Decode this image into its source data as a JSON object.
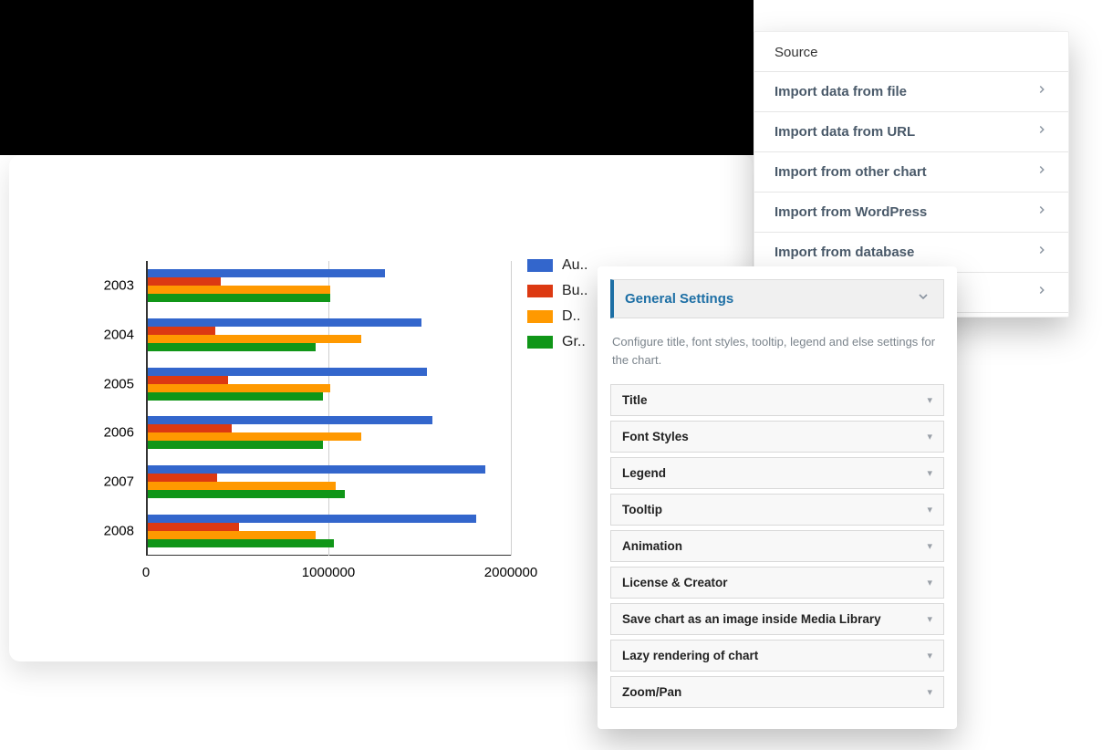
{
  "chart_data": {
    "type": "bar",
    "orientation": "horizontal",
    "categories": [
      "2003",
      "2004",
      "2005",
      "2006",
      "2007",
      "2008"
    ],
    "series": [
      {
        "name": "Au..",
        "color": "#3366cc",
        "values": [
          1300000,
          1500000,
          1530000,
          1560000,
          1850000,
          1800000
        ]
      },
      {
        "name": "Bu..",
        "color": "#dc3912",
        "values": [
          400000,
          370000,
          440000,
          460000,
          380000,
          500000
        ]
      },
      {
        "name": "D..",
        "color": "#ff9900",
        "values": [
          1000000,
          1170000,
          1000000,
          1170000,
          1030000,
          920000
        ]
      },
      {
        "name": "Gr..",
        "color": "#109618",
        "values": [
          1000000,
          920000,
          960000,
          960000,
          1080000,
          1020000
        ]
      }
    ],
    "xlim": [
      0,
      2000000
    ],
    "xticks": [
      0,
      1000000,
      2000000
    ],
    "xtick_labels": [
      "0",
      "1000000",
      "2000000"
    ]
  },
  "source": {
    "title": "Source",
    "items": [
      "Import data from file",
      "Import data from URL",
      "Import from other chart",
      "Import from WordPress",
      "Import from database",
      ""
    ]
  },
  "settings": {
    "header": "General Settings",
    "description": "Configure title, font styles, tooltip, legend and else settings for the chart.",
    "items": [
      "Title",
      "Font Styles",
      "Legend",
      "Tooltip",
      "Animation",
      "License & Creator",
      "Save chart as an image inside Media Library",
      "Lazy rendering of chart",
      "Zoom/Pan"
    ]
  }
}
